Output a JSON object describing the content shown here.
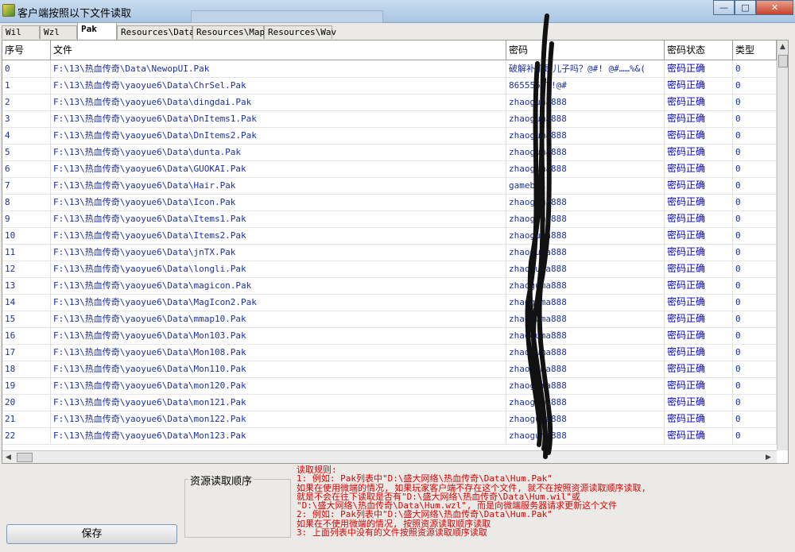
{
  "window": {
    "title": "客户端按照以下文件读取",
    "controls": [
      "minimize-icon",
      "maximize-icon",
      "close-icon"
    ]
  },
  "tabs": [
    {
      "label": "Wil",
      "active": false
    },
    {
      "label": "Wzl",
      "active": false
    },
    {
      "label": "Pak",
      "active": true
    },
    {
      "label": "Resources\\Data",
      "active": false
    },
    {
      "label": "Resources\\Map",
      "active": false
    },
    {
      "label": "Resources\\Wav",
      "active": false
    }
  ],
  "table": {
    "columns": [
      "序号",
      "文件",
      "密码",
      "密码状态",
      "类型"
    ],
    "rows": [
      [
        "0",
        "F:\\13\\热血传奇\\Data\\NewopUI.Pak",
        "破解补丁是儿子吗？@#! @#……%&(",
        "密码正确",
        "0"
      ],
      [
        "1",
        "F:\\13\\热血传奇\\yaoyue6\\Data\\ChrSel.Pak",
        "86555577!@#",
        "密码正确",
        "0"
      ],
      [
        "2",
        "F:\\13\\热血传奇\\yaoyue6\\Data\\dingdai.Pak",
        "zhaoguma888",
        "密码正确",
        "0"
      ],
      [
        "3",
        "F:\\13\\热血传奇\\yaoyue6\\Data\\DnItems1.Pak",
        "zhaoguma888",
        "密码正确",
        "0"
      ],
      [
        "4",
        "F:\\13\\热血传奇\\yaoyue6\\Data\\DnItems2.Pak",
        "zhaoguma888",
        "密码正确",
        "0"
      ],
      [
        "5",
        "F:\\13\\热血传奇\\yaoyue6\\Data\\dunta.Pak",
        "zhaoguma888",
        "密码正确",
        "0"
      ],
      [
        "6",
        "F:\\13\\热血传奇\\yaoyue6\\Data\\GUOKAI.Pak",
        "zhaoguma888",
        "密码正确",
        "0"
      ],
      [
        "7",
        "F:\\13\\热血传奇\\yaoyue6\\Data\\Hair.Pak",
        "gamebai",
        "密码正确",
        "0"
      ],
      [
        "8",
        "F:\\13\\热血传奇\\yaoyue6\\Data\\Icon.Pak",
        "zhaoguma888",
        "密码正确",
        "0"
      ],
      [
        "9",
        "F:\\13\\热血传奇\\yaoyue6\\Data\\Items1.Pak",
        "zhaoguma888",
        "密码正确",
        "0"
      ],
      [
        "10",
        "F:\\13\\热血传奇\\yaoyue6\\Data\\Items2.Pak",
        "zhaoguma888",
        "密码正确",
        "0"
      ],
      [
        "11",
        "F:\\13\\热血传奇\\yaoyue6\\Data\\jnTX.Pak",
        "zhaoguma888",
        "密码正确",
        "0"
      ],
      [
        "12",
        "F:\\13\\热血传奇\\yaoyue6\\Data\\longli.Pak",
        "zhaoguma888",
        "密码正确",
        "0"
      ],
      [
        "13",
        "F:\\13\\热血传奇\\yaoyue6\\Data\\magicon.Pak",
        "zhaoguma888",
        "密码正确",
        "0"
      ],
      [
        "14",
        "F:\\13\\热血传奇\\yaoyue6\\Data\\MagIcon2.Pak",
        "zhaoguma888",
        "密码正确",
        "0"
      ],
      [
        "15",
        "F:\\13\\热血传奇\\yaoyue6\\Data\\mmap10.Pak",
        "zhaoguma888",
        "密码正确",
        "0"
      ],
      [
        "16",
        "F:\\13\\热血传奇\\yaoyue6\\Data\\Mon103.Pak",
        "zhaoguma888",
        "密码正确",
        "0"
      ],
      [
        "17",
        "F:\\13\\热血传奇\\yaoyue6\\Data\\Mon108.Pak",
        "zhaoguma888",
        "密码正确",
        "0"
      ],
      [
        "18",
        "F:\\13\\热血传奇\\yaoyue6\\Data\\Mon110.Pak",
        "zhaoguma888",
        "密码正确",
        "0"
      ],
      [
        "19",
        "F:\\13\\热血传奇\\yaoyue6\\Data\\mon120.Pak",
        "zhaoguma888",
        "密码正确",
        "0"
      ],
      [
        "20",
        "F:\\13\\热血传奇\\yaoyue6\\Data\\mon121.Pak",
        "zhaoguma888",
        "密码正确",
        "0"
      ],
      [
        "21",
        "F:\\13\\热血传奇\\yaoyue6\\Data\\mon122.Pak",
        "zhaoguma888",
        "密码正确",
        "0"
      ],
      [
        "22",
        "F:\\13\\热血传奇\\yaoyue6\\Data\\Mon123.Pak",
        "zhaoguma888",
        "密码正确",
        "0"
      ]
    ]
  },
  "footer": {
    "save_label": "保存",
    "group_label": "资源读取顺序",
    "rules": [
      "读取规则:",
      "1: 例如: Pak列表中\"D:\\盛大网络\\热血传奇\\Data\\Hum.Pak\"",
      "   如果在使用微端的情况, 如果玩家客户端不存在这个文件, 就不在按照资源读取顺序读取,",
      "   就是不会在往下读取是否有\"D:\\盛大网络\\热血传奇\\Data\\Hum.wil\"或",
      "   \"D:\\盛大网络\\热血传奇\\Data\\Hum.wzl\", 而是向微端服务器请求更新这个文件",
      "2: 例如: Pak列表中\"D:\\盛大网络\\热血传奇\\Data\\Hum.Pak\"",
      "   如果在不使用微端的情况, 按照资源读取顺序读取",
      "3: 上面列表中没有的文件按照资源读取顺序读取"
    ]
  },
  "colors": {
    "cell_text": "#1a2fa8",
    "rules_text": "#e00000",
    "window_bg": "#eceae6"
  }
}
